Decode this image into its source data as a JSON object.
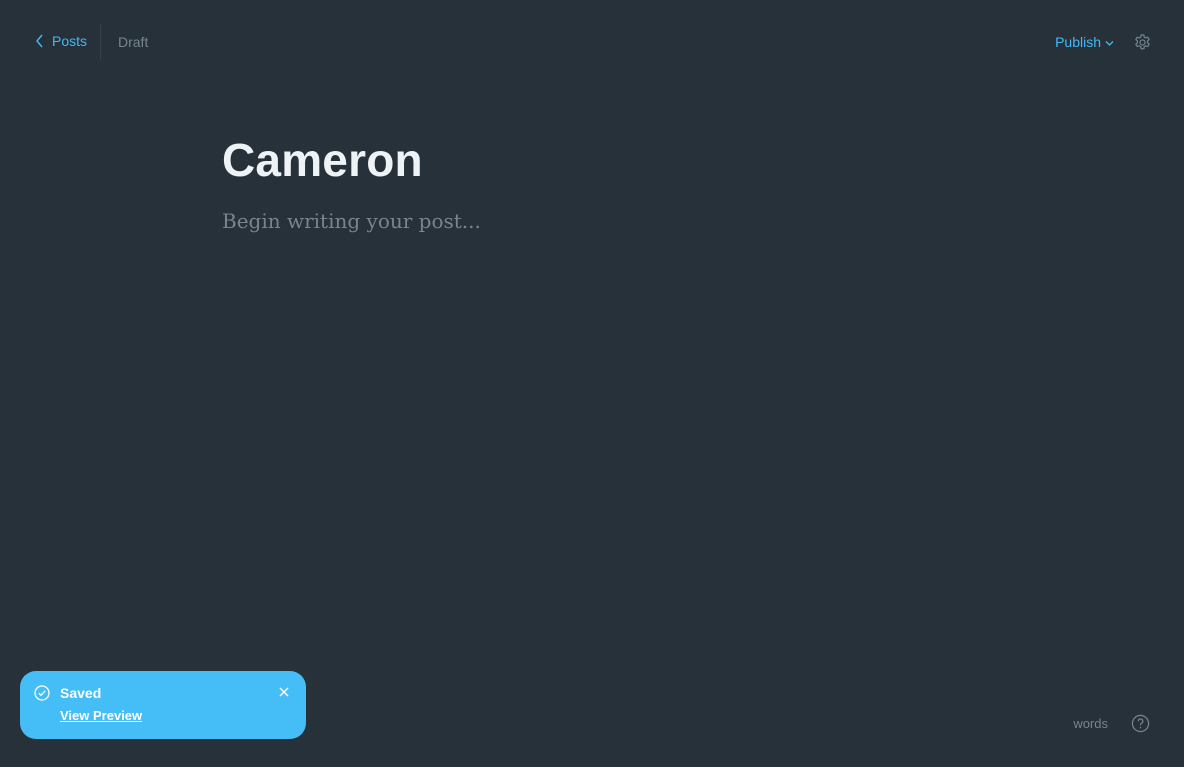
{
  "header": {
    "back_label": "Posts",
    "status": "Draft",
    "publish_label": "Publish"
  },
  "editor": {
    "title": "Cameron",
    "body_placeholder": "Begin writing your post..."
  },
  "toast": {
    "title": "Saved",
    "link_label": "View Preview"
  },
  "footer": {
    "word_count_label": "words"
  },
  "icons": {
    "back": "chevron-left-icon",
    "publish_dropdown": "chevron-down-icon",
    "settings": "gear-icon",
    "toast_status": "check-circle-icon",
    "toast_close": "close-icon",
    "help": "question-circle-icon"
  },
  "colors": {
    "background": "#26313a",
    "accent": "#45b8f5",
    "toast": "#45bdf6",
    "muted_text": "#76858f",
    "title_text": "#eef3f6"
  }
}
